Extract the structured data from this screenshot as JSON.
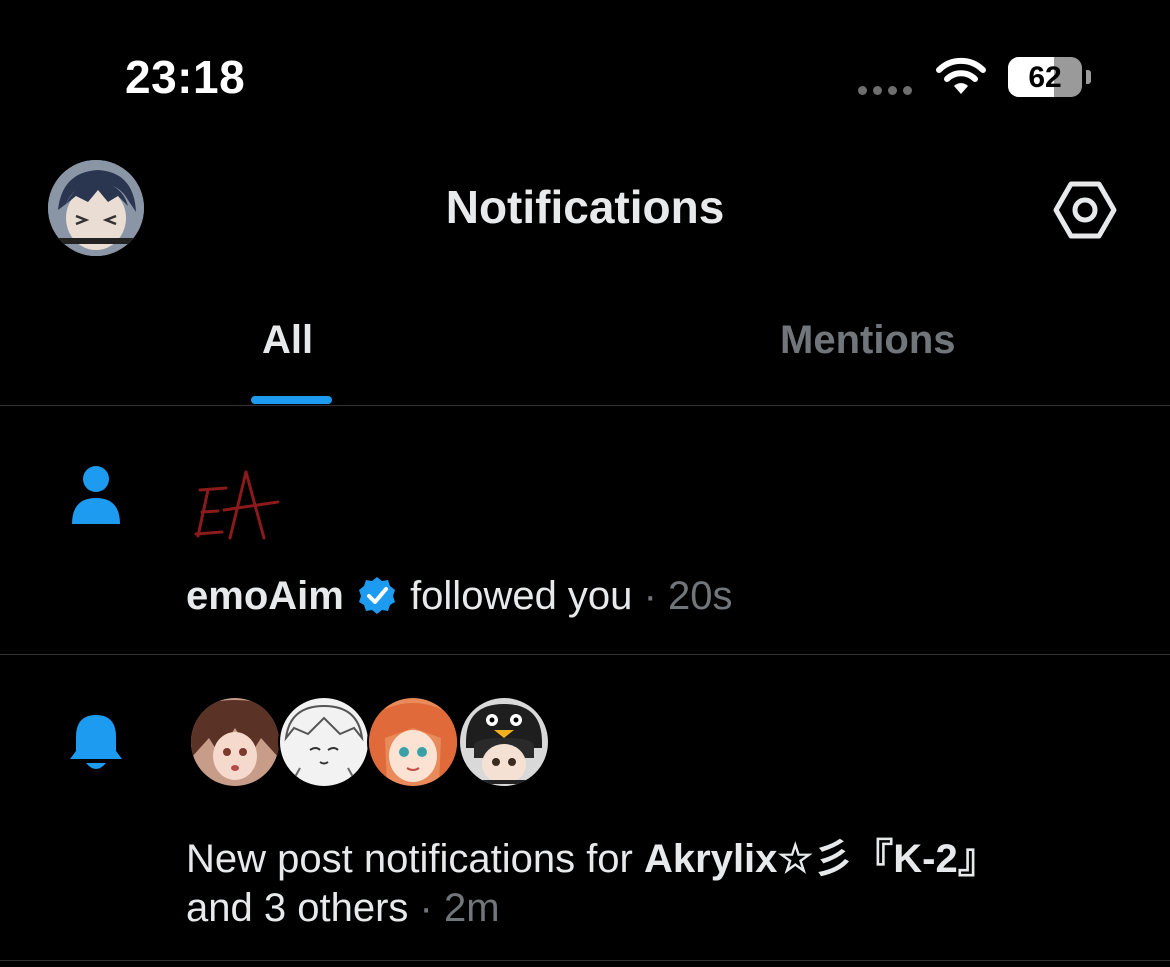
{
  "status_bar": {
    "time": "23:18",
    "battery_percent": "62",
    "battery_level": 0.62,
    "icons": [
      "signal-dots-icon",
      "wifi-icon",
      "battery-icon"
    ]
  },
  "header": {
    "title": "Notifications",
    "settings_icon": "gear-icon"
  },
  "tabs": [
    {
      "label": "All",
      "active": true
    },
    {
      "label": "Mentions",
      "active": false
    }
  ],
  "notifications": [
    {
      "type": "follow",
      "icon": "person-icon",
      "user_logo_text": "EA",
      "user_name": "emoAim",
      "verified": true,
      "action": "followed you",
      "separator": "·",
      "time": "20s"
    },
    {
      "type": "new_post",
      "icon": "bell-icon",
      "avatar_count": 4,
      "line1_prefix": "New post notifications for ",
      "line1_name": "Akrylix☆彡『K-2』",
      "line2_text": "and 3 others",
      "separator": "·",
      "time": "2m"
    }
  ],
  "colors": {
    "background": "#000000",
    "accent": "#1d9bf0",
    "text_primary": "#e7e9ea",
    "text_muted": "#71767b",
    "divider": "#2f3336",
    "logo_red": "#8b1a1a"
  }
}
